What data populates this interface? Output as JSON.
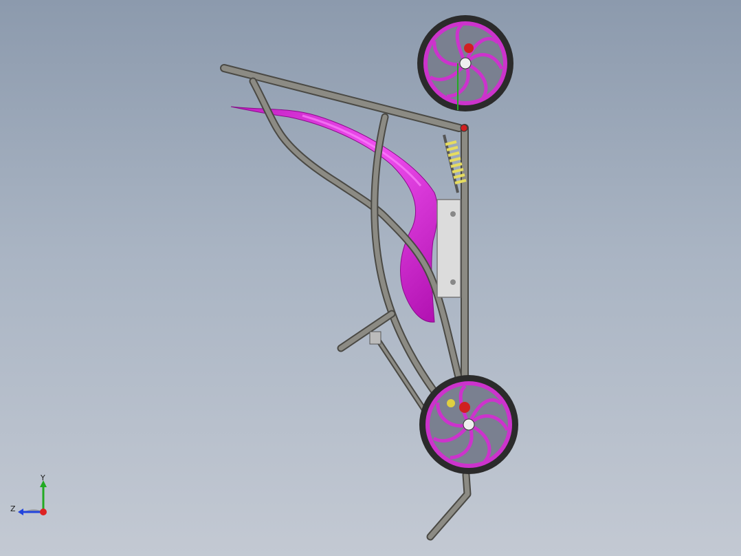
{
  "window": {
    "background_top": "#8c9aad",
    "background_bottom": "#c3c9d3"
  },
  "model": {
    "frame_color": "#6b6a63",
    "body_panel_color": "#e020e0",
    "wheel_rim_color": "#cc33cc",
    "tire_color": "#2b2b2b",
    "spring_color": "#e8e070",
    "mount_plate_color": "#d8d8d8",
    "brake_caliper_color": "#d02020"
  },
  "triad": {
    "y_label": "Y",
    "z_label": "Z",
    "y_color": "#22aa22",
    "z_color": "#2244dd",
    "x_color": "#dd2222"
  }
}
